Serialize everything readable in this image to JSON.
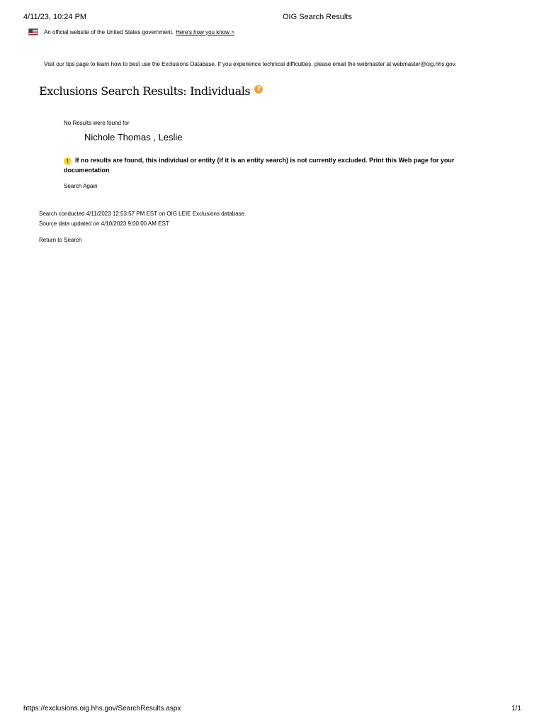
{
  "print_header": {
    "datetime": "4/11/23, 10:24 PM",
    "page_title": "OIG Search Results"
  },
  "gov_banner": {
    "text": "An official website of the United States government.",
    "link": "Here's how you know >"
  },
  "tips": "Visit our tips page to learn how to best use the Exclusions Database. If you experience technical difficulties, please email the webmaster at webmaster@oig.hhs.gov.",
  "heading": "Exclusions Search Results: Individuals",
  "result": {
    "no_results_label": "No Results were found for",
    "searched_name": "Nichole Thomas , Leslie",
    "warning": "If no results are found, this individual or entity (if it is an entity search) is not currently excluded. Print this Web page for your documentation",
    "search_again": "Search Again"
  },
  "meta": {
    "conducted": "Search conducted 4/11/2023 12:53:57 PM EST on OIG LEIE Exclusions database.",
    "updated": "Source data updated on 4/10/2023 9:00:00 AM EST"
  },
  "return_link": "Return to Search",
  "print_footer": {
    "url": "https://exclusions.oig.hhs.gov/SearchResults.aspx",
    "page": "1/1"
  }
}
